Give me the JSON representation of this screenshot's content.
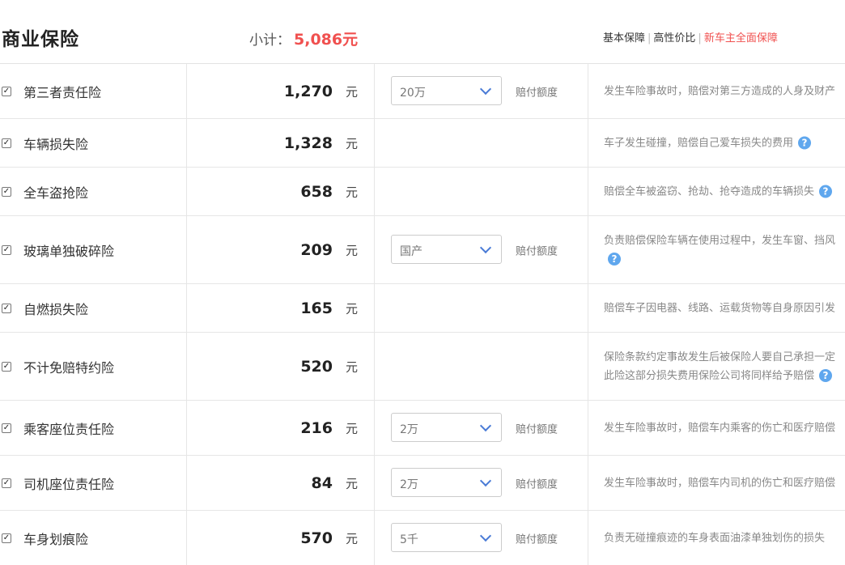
{
  "header": {
    "title": "商业保险",
    "subtotal_label": "小计：",
    "subtotal_value": "5,086元",
    "plans": [
      "基本保障",
      "高性价比",
      "新车主全面保障"
    ]
  },
  "unit": "元",
  "limit_label": "赔付额度",
  "rows": [
    {
      "name": "第三者责任险",
      "price": "1,270",
      "select": "20万",
      "desc": "发生车险事故时，赔偿对第三方造成的人身及财产"
    },
    {
      "name": "车辆损失险",
      "price": "1,328",
      "select": "",
      "desc": "车子发生碰撞，赔偿自己爱车损失的费用"
    },
    {
      "name": "全车盗抢险",
      "price": "658",
      "select": "",
      "desc": "赔偿全车被盗窃、抢劫、抢夺造成的车辆损失"
    },
    {
      "name": "玻璃单独破碎险",
      "price": "209",
      "select": "国产",
      "desc": "负责赔偿保险车辆在使用过程中，发生车窗、挡风"
    },
    {
      "name": "自燃损失险",
      "price": "165",
      "select": "",
      "desc": "赔偿车子因电器、线路、运载货物等自身原因引发"
    },
    {
      "name": "不计免赔特约险",
      "price": "520",
      "select": "",
      "desc": "保险条款约定事故发生后被保险人要自己承担一定",
      "desc2": "此险这部分损失费用保险公司将同样给予赔偿"
    },
    {
      "name": "乘客座位责任险",
      "price": "216",
      "select": "2万",
      "desc": "发生车险事故时，赔偿车内乘客的伤亡和医疗赔偿"
    },
    {
      "name": "司机座位责任险",
      "price": "84",
      "select": "2万",
      "desc": "发生车险事故时，赔偿车内司机的伤亡和医疗赔偿"
    },
    {
      "name": "车身划痕险",
      "price": "570",
      "select": "5千",
      "desc": "负责无碰撞痕迹的车身表面油漆单独划伤的损失"
    }
  ]
}
